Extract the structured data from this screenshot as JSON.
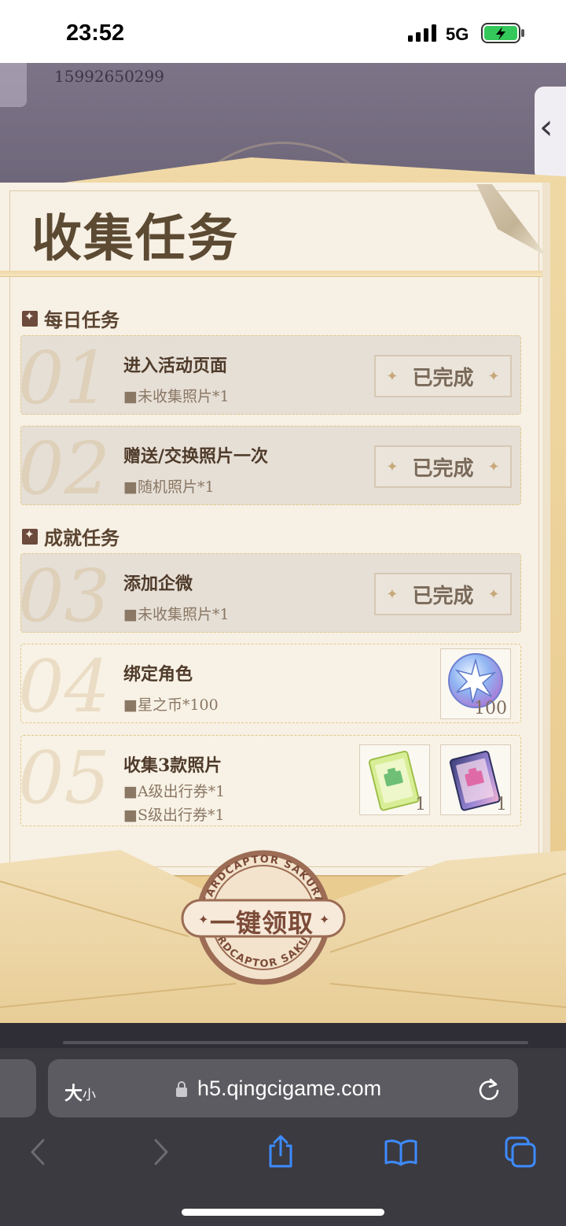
{
  "status_bar": {
    "time": "23:52",
    "network": "5G"
  },
  "header": {
    "phone_number": "15992650299"
  },
  "panel": {
    "title": "收集任务",
    "daily_section": "每日任务",
    "achievement_section": "成就任务",
    "done_label": "已完成",
    "tasks": [
      {
        "num": "01",
        "title": "进入活动页面",
        "rewards": [
          "■未收集照片*1"
        ],
        "status": "done"
      },
      {
        "num": "02",
        "title": "赠送/交换照片一次",
        "rewards": [
          "■随机照片*1"
        ],
        "status": "done"
      },
      {
        "num": "03",
        "title": "添加企微",
        "rewards": [
          "■未收集照片*1"
        ],
        "status": "done"
      },
      {
        "num": "04",
        "title": "绑定角色",
        "rewards": [
          "■星之币*100"
        ],
        "status": "todo",
        "reward_items": [
          {
            "icon": "star-coin-icon",
            "qty": "100"
          }
        ]
      },
      {
        "num": "05",
        "title": "收集3款照片",
        "rewards": [
          "■A级出行券*1",
          "■S级出行券*1"
        ],
        "status": "todo",
        "reward_items": [
          {
            "icon": "a-ticket-icon",
            "qty": "1"
          },
          {
            "icon": "s-ticket-icon",
            "qty": "1"
          }
        ]
      }
    ],
    "claim_button": "一键领取",
    "seal_text": "CARDCAPTOR SAKURA"
  },
  "browser": {
    "aa_label": "大",
    "aa_small": "小",
    "url": "h5.qingcigame.com"
  },
  "colors": {
    "paper": "#f7f0e4",
    "envelope": "#e8c98b",
    "accent_brown": "#5c4a33"
  }
}
